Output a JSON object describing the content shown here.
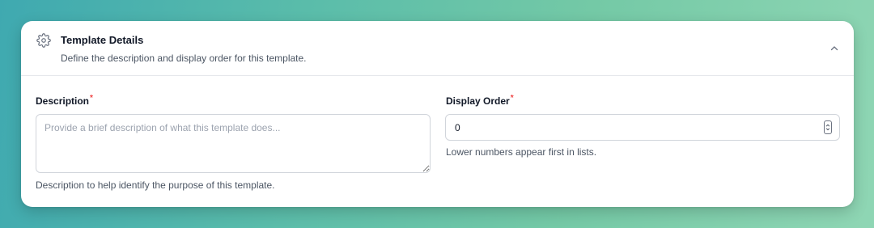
{
  "card": {
    "title": "Template Details",
    "subtitle": "Define the description and display order for this template."
  },
  "description_field": {
    "label": "Description",
    "required_marker": "*",
    "placeholder": "Provide a brief description of what this template does...",
    "value": "",
    "help": "Description to help identify the purpose of this template."
  },
  "display_order_field": {
    "label": "Display Order",
    "required_marker": "*",
    "value": "0",
    "help": "Lower numbers appear first in lists."
  },
  "icons": {
    "header": "gear-icon",
    "collapse": "chevron-up-icon",
    "spinner": "spinner-arrows-icon"
  },
  "colors": {
    "required": "#ef4444",
    "background_start": "#3fa9b0",
    "background_end": "#8fd6b4"
  }
}
